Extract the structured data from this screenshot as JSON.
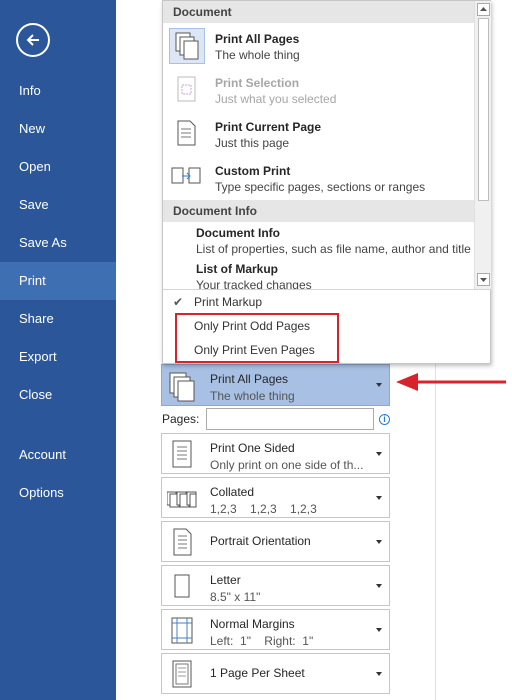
{
  "sidebar": {
    "items": [
      {
        "label": "Info"
      },
      {
        "label": "New"
      },
      {
        "label": "Open"
      },
      {
        "label": "Save"
      },
      {
        "label": "Save As"
      },
      {
        "label": "Print",
        "active": true
      },
      {
        "label": "Share"
      },
      {
        "label": "Export"
      },
      {
        "label": "Close"
      },
      {
        "label": "Account"
      },
      {
        "label": "Options"
      }
    ]
  },
  "popup": {
    "document_header": "Document",
    "options": [
      {
        "title": "Print All Pages",
        "desc": "The whole thing",
        "icon": "all-pages-icon"
      },
      {
        "title": "Print Selection",
        "desc": "Just what you selected",
        "icon": "selection-icon"
      },
      {
        "title": "Print Current Page",
        "desc": "Just this page",
        "icon": "current-page-icon"
      },
      {
        "title": "Custom Print",
        "desc": "Type specific pages, sections or ranges",
        "icon": "custom-print-icon"
      }
    ],
    "doc_info_header": "Document Info",
    "info_items": [
      {
        "title": "Document Info",
        "desc": "List of properties, such as file name, author and title"
      },
      {
        "title": "List of Markup",
        "desc": "Your tracked changes"
      }
    ],
    "toggles": [
      "Print Markup",
      "Only Print Odd Pages",
      "Only Print Even Pages"
    ]
  },
  "settings": {
    "print_range": {
      "title": "Print All Pages",
      "desc": "The whole thing"
    },
    "pages_label": "Pages:",
    "pages_value": "",
    "sided": {
      "title": "Print One Sided",
      "desc": "Only print on one side of th..."
    },
    "collation": {
      "title": "Collated",
      "desc": "1,2,3    1,2,3    1,2,3"
    },
    "orientation": {
      "title": "Portrait Orientation"
    },
    "paper": {
      "title": "Letter",
      "desc": "8.5\" x 11\""
    },
    "margins": {
      "title": "Normal Margins",
      "desc": "Left:  1\"    Right:  1\""
    },
    "per_sheet": {
      "title": "1 Page Per Sheet"
    }
  },
  "colors": {
    "sidebar": "#2b579a",
    "sidebar_active": "#3f6fb3",
    "highlight": "#a7c0e3",
    "annotation": "#d9232c"
  }
}
